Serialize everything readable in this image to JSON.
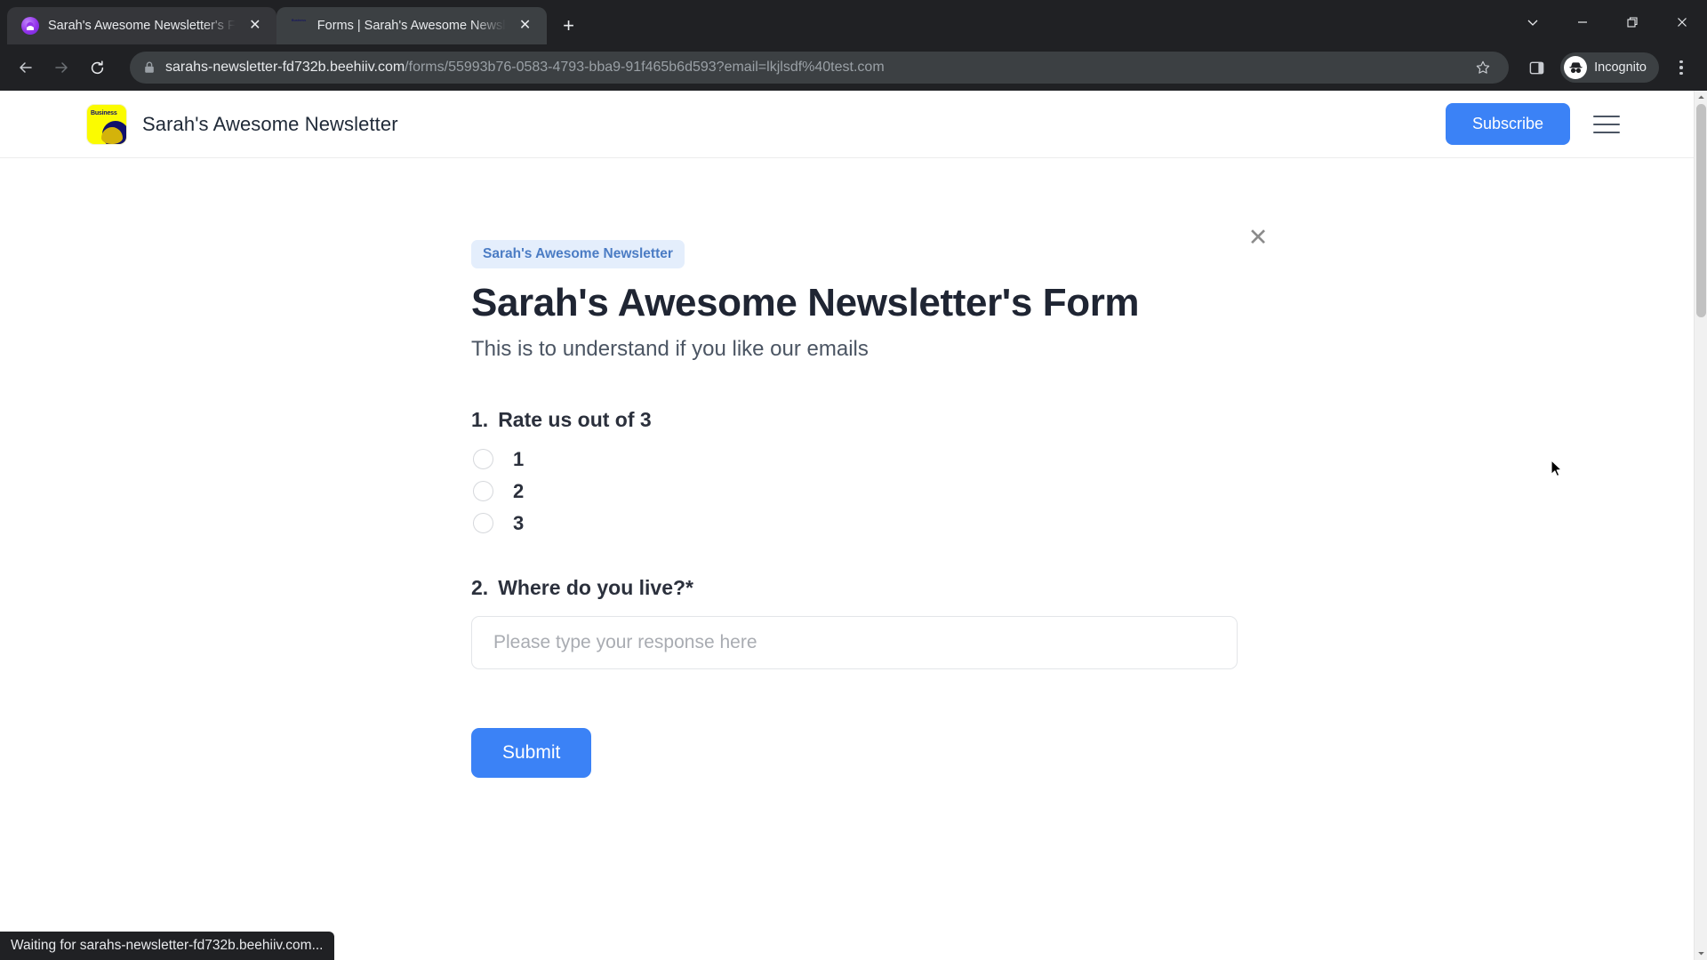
{
  "browser": {
    "tabs": [
      {
        "title": "Sarah's Awesome Newsletter's F",
        "favicon": "beehiiv-logo-icon",
        "active": false,
        "close_label": "✕"
      },
      {
        "title": "Forms | Sarah's Awesome Newsl",
        "favicon": "business-logo-icon",
        "active": true,
        "close_label": "✕"
      }
    ],
    "new_tab_label": "+",
    "window_controls": {
      "tab_search": "tab-search-chevron",
      "minimize": "minimize",
      "restore": "restore",
      "close": "close"
    },
    "nav": {
      "back": "back-arrow",
      "forward": "forward-arrow",
      "reload": "reload"
    },
    "omnibox": {
      "lock": "lock-icon",
      "url_host": "sarahs-newsletter-fd732b.beehiiv.com",
      "url_path": "/forms/55993b76-0583-4793-bba9-91f465b6d593?email=lkjlsdf%40test.com",
      "star": "bookmark-star-icon"
    },
    "toolbar": {
      "side_panel": "side-panel-icon",
      "incognito_label": "Incognito",
      "menu": "kebab-menu-icon"
    },
    "status_text": "Waiting for sarahs-newsletter-fd732b.beehiiv.com..."
  },
  "site": {
    "brand_name": "Sarah's Awesome Newsletter",
    "subscribe_label": "Subscribe",
    "menu_icon": "hamburger-menu-icon"
  },
  "form": {
    "badge": "Sarah's Awesome Newsletter",
    "title": "Sarah's Awesome Newsletter's Form",
    "subtitle": "This is to understand if you like our emails",
    "close_label": "✕",
    "questions": [
      {
        "number": "1.",
        "label": "Rate us out of 3",
        "type": "radio",
        "options": [
          "1",
          "2",
          "3"
        ],
        "selected": null
      },
      {
        "number": "2.",
        "label": "Where do you live?*",
        "type": "text",
        "value": "",
        "placeholder": "Please type your response here"
      }
    ],
    "submit_label": "Submit"
  },
  "colors": {
    "accent_blue": "#3b82f6",
    "badge_bg": "#e4eefc",
    "badge_text": "#4b7cc4",
    "chrome_dark": "#202124",
    "logo_yellow": "#fbfb00",
    "logo_navy": "#10106b"
  }
}
